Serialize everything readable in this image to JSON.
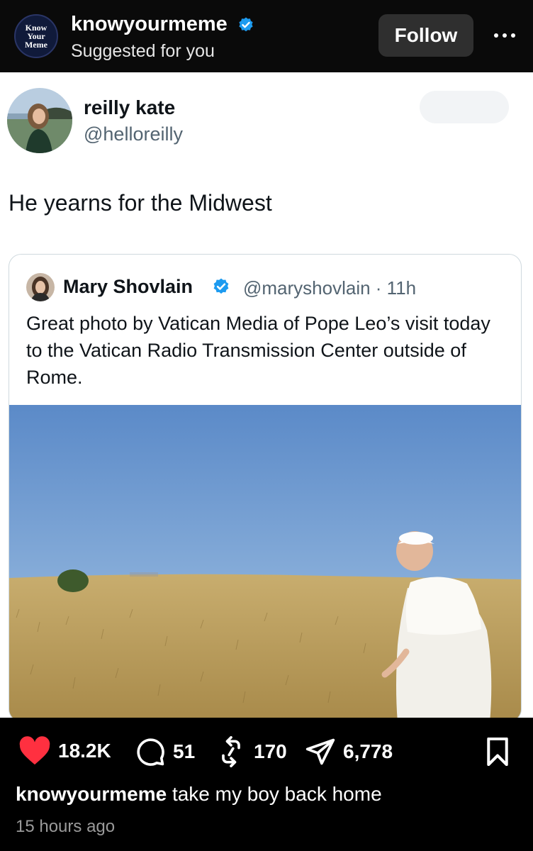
{
  "header": {
    "logo_lines": [
      "Know",
      "Your",
      "Meme"
    ],
    "account_name": "knowyourmeme",
    "subtitle": "Suggested for you",
    "follow_label": "Follow"
  },
  "tweet": {
    "author_name": "reilly kate",
    "author_handle": "@helloreilly",
    "text": "He yearns for the Midwest",
    "quote": {
      "author_name": "Mary Shovlain",
      "author_handle": "@maryshovlain",
      "time": "· 11h",
      "text": "Great photo by Vatican Media of Pope Leo’s visit today to the Vatican Radio Transmission Center outside of Rome."
    }
  },
  "actions": {
    "likes": "18.2K",
    "comments": "51",
    "reposts": "170",
    "shares": "6,778"
  },
  "caption": {
    "username": "knowyourmeme",
    "text": "take my boy back home"
  },
  "timestamp": "15 hours ago",
  "colors": {
    "like_red": "#ff3040",
    "verified_blue": "#1d9bf0",
    "tweet_text": "#0f1419",
    "tweet_secondary": "#536471"
  }
}
